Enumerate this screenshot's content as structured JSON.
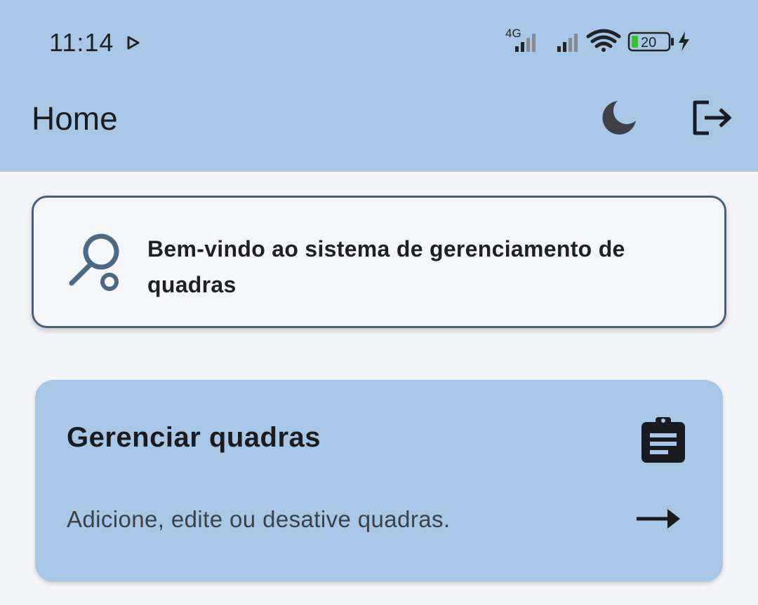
{
  "status_bar": {
    "time": "11:14",
    "network_label": "4G",
    "battery_level": "20"
  },
  "app_bar": {
    "title": "Home"
  },
  "welcome_card": {
    "message": "Bem-vindo ao sistema de gerenciamento de quadras"
  },
  "manage_card": {
    "title": "Gerenciar quadras",
    "description": "Adicione, edite ou desative quadras."
  },
  "colors": {
    "header_bg": "#a8c7e6",
    "page_bg": "#f4f5f9",
    "card_border": "#4a6078",
    "racket_icon": "#4b6983",
    "battery_green": "#35c230"
  },
  "icons": {
    "play": "play-store-notification-icon",
    "signal": "cell-signal-icon",
    "wifi": "wifi-icon",
    "battery": "battery-icon",
    "charging": "charging-bolt-icon",
    "theme": "moon-icon",
    "logout": "logout-icon",
    "welcome": "tennis-racket-icon",
    "manage": "clipboard-icon",
    "go": "arrow-right-icon"
  }
}
